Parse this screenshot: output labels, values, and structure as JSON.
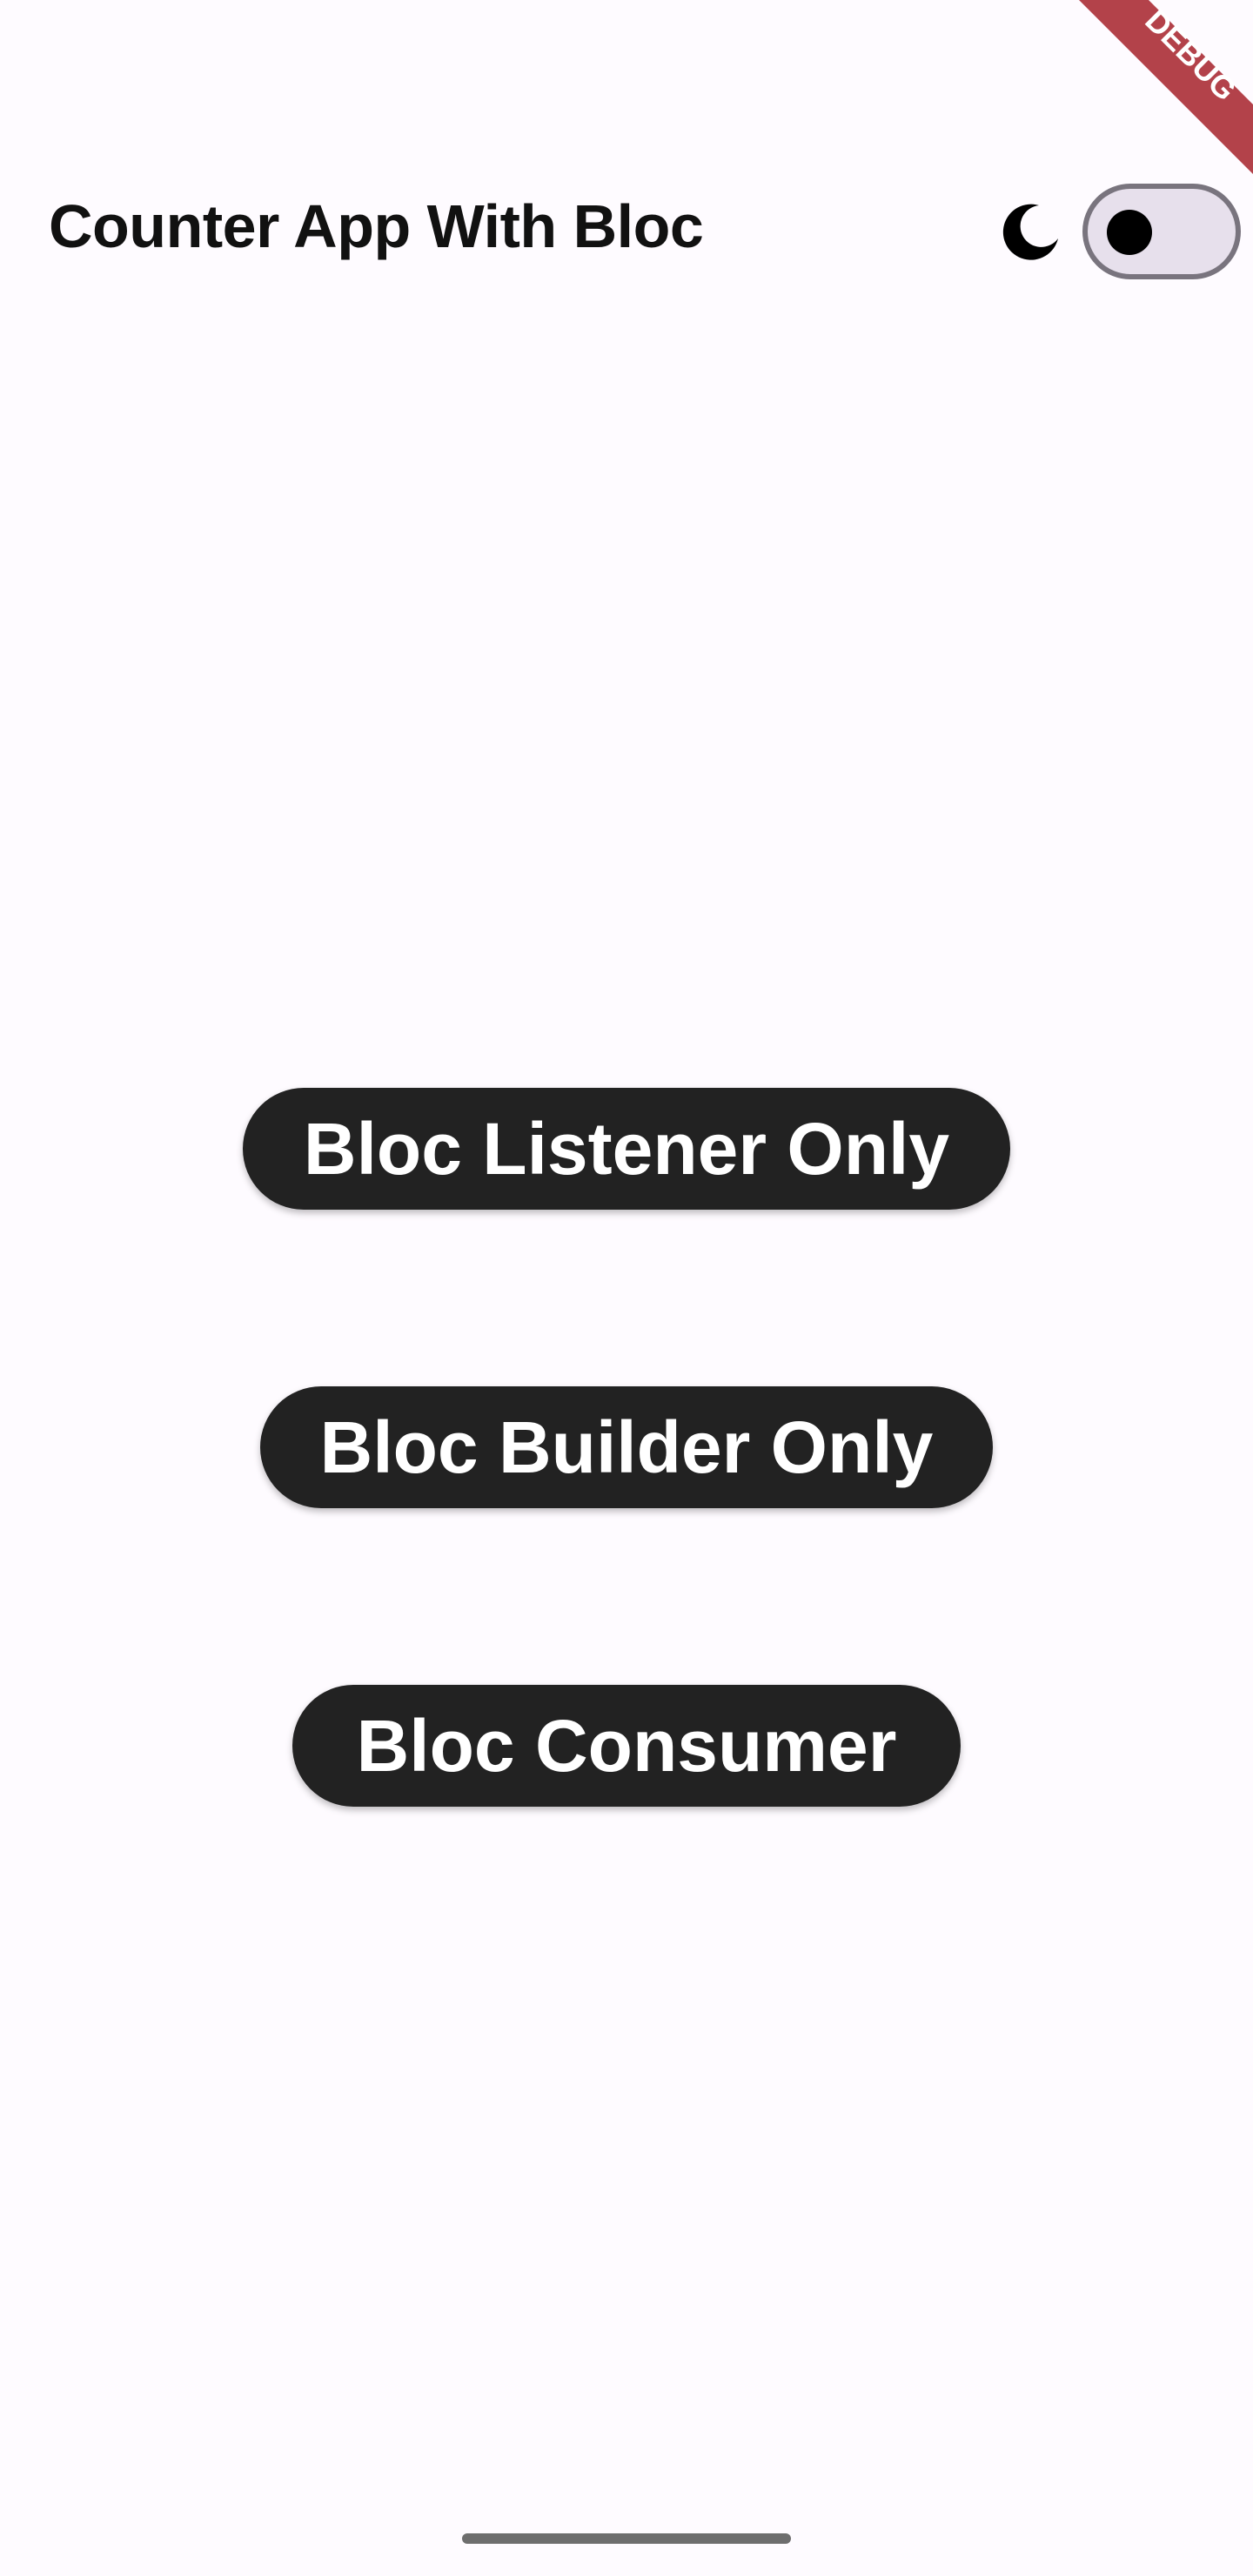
{
  "app_bar": {
    "title": "Counter App With Bloc",
    "theme_icon": "moon-icon",
    "dark_mode_switch_on": false
  },
  "buttons": {
    "listener_label": "Bloc Listener Only",
    "builder_label": "Bloc Builder Only",
    "consumer_label": "Bloc Consumer"
  },
  "debug_banner": {
    "label": "DEBUG",
    "color": "#b3424a"
  },
  "colors": {
    "background": "#fefbff",
    "button_fill": "#222222",
    "button_text": "#ffffff",
    "switch_track": "#e7e0ec",
    "switch_border": "#79747e"
  }
}
